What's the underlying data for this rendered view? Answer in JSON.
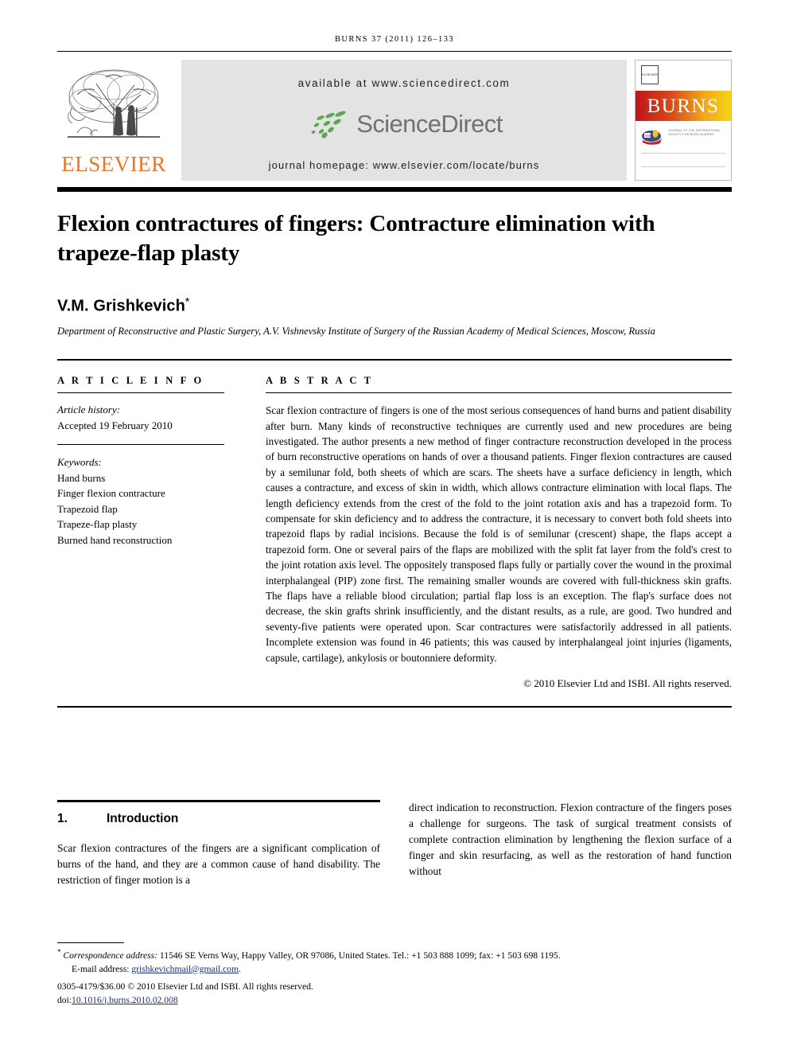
{
  "running_head": "BURNS 37 (2011) 126–133",
  "masthead": {
    "publisher_name": "ELSEVIER",
    "publisher_logo_icon": "elsevier-tree-icon",
    "available_at": "available at www.sciencedirect.com",
    "sciencedirect_wordmark": "ScienceDirect",
    "sciencedirect_logo_icon": "sciencedirect-swoosh-icon",
    "journal_homepage": "journal homepage: www.elsevier.com/locate/burns",
    "cover": {
      "mini_publisher_label": "ELSEVIER",
      "journal_name": "BURNS",
      "society_mark_icon": "isbi-logo-icon",
      "society_text": "JOURNAL OF THE INTERNATIONAL SOCIETY FOR BURN INJURIES"
    }
  },
  "article": {
    "title": "Flexion contractures of fingers: Contracture elimination with trapeze-flap plasty",
    "author": "V.M. Grishkevich",
    "author_marker": "*",
    "affiliation": "Department of Reconstructive and Plastic Surgery, A.V. Vishnevsky Institute of Surgery of the Russian Academy of Medical Sciences, Moscow, Russia"
  },
  "article_info": {
    "heading": "A R T I C L E  I N F O",
    "history_label": "Article history:",
    "history_value": "Accepted 19 February 2010",
    "keywords_label": "Keywords:",
    "keywords": [
      "Hand burns",
      "Finger flexion contracture",
      "Trapezoid flap",
      "Trapeze-flap plasty",
      "Burned hand reconstruction"
    ]
  },
  "abstract": {
    "heading": "A B S T R A C T",
    "text": "Scar flexion contracture of fingers is one of the most serious consequences of hand burns and patient disability after burn. Many kinds of reconstructive techniques are currently used and new procedures are being investigated. The author presents a new method of finger contracture reconstruction developed in the process of burn reconstructive operations on hands of over a thousand patients. Finger flexion contractures are caused by a semilunar fold, both sheets of which are scars. The sheets have a surface deficiency in length, which causes a contracture, and excess of skin in width, which allows contracture elimination with local flaps. The length deficiency extends from the crest of the fold to the joint rotation axis and has a trapezoid form. To compensate for skin deficiency and to address the contracture, it is necessary to convert both fold sheets into trapezoid flaps by radial incisions. Because the fold is of semilunar (crescent) shape, the flaps accept a trapezoid form. One or several pairs of the flaps are mobilized with the split fat layer from the fold's crest to the joint rotation axis level. The oppositely transposed flaps fully or partially cover the wound in the proximal interphalangeal (PIP) zone first. The remaining smaller wounds are covered with full-thickness skin grafts. The flaps have a reliable blood circulation; partial flap loss is an exception. The flap's surface does not decrease, the skin grafts shrink insufficiently, and the distant results, as a rule, are good. Two hundred and seventy-five patients were operated upon. Scar contractures were satisfactorily addressed in all patients. Incomplete extension was found in 46 patients; this was caused by interphalangeal joint injuries (ligaments, capsule, cartilage), ankylosis or boutonniere deformity.",
    "copyright": "© 2010 Elsevier Ltd and ISBI. All rights reserved."
  },
  "body": {
    "section_number": "1.",
    "section_title": "Introduction",
    "left_paragraph": "Scar flexion contractures of the fingers are a significant complication of burns of the hand, and they are a common cause of hand disability. The restriction of finger motion is a",
    "right_paragraph": "direct indication to reconstruction. Flexion contracture of the fingers poses a challenge for surgeons. The task of surgical treatment consists of complete contraction elimination by lengthening the flexion surface of a finger and skin resurfacing, as well as the restoration of hand function without"
  },
  "footer": {
    "corr_marker": "*",
    "corr_label": "Correspondence address:",
    "corr_value": "11546 SE Verns Way, Happy Valley, OR 97086, United States. Tel.: +1 503 888 1099; fax: +1 503 698 1195.",
    "email_label": "E-mail address:",
    "email_value": "grishkevichmail@gmail.com",
    "email_suffix": ".",
    "issn_line": "0305-4179/$36.00 © 2010 Elsevier Ltd and ISBI. All rights reserved.",
    "doi_label": "doi:",
    "doi_value": "10.1016/j.burns.2010.02.008"
  },
  "colors": {
    "elsevier_orange": "#E87722",
    "sciencedirect_green": "#5aa84f",
    "sciencedirect_gray": "#6f7271",
    "link_blue": "#1a2e7a",
    "banner_gray": "#e3e3e3"
  }
}
